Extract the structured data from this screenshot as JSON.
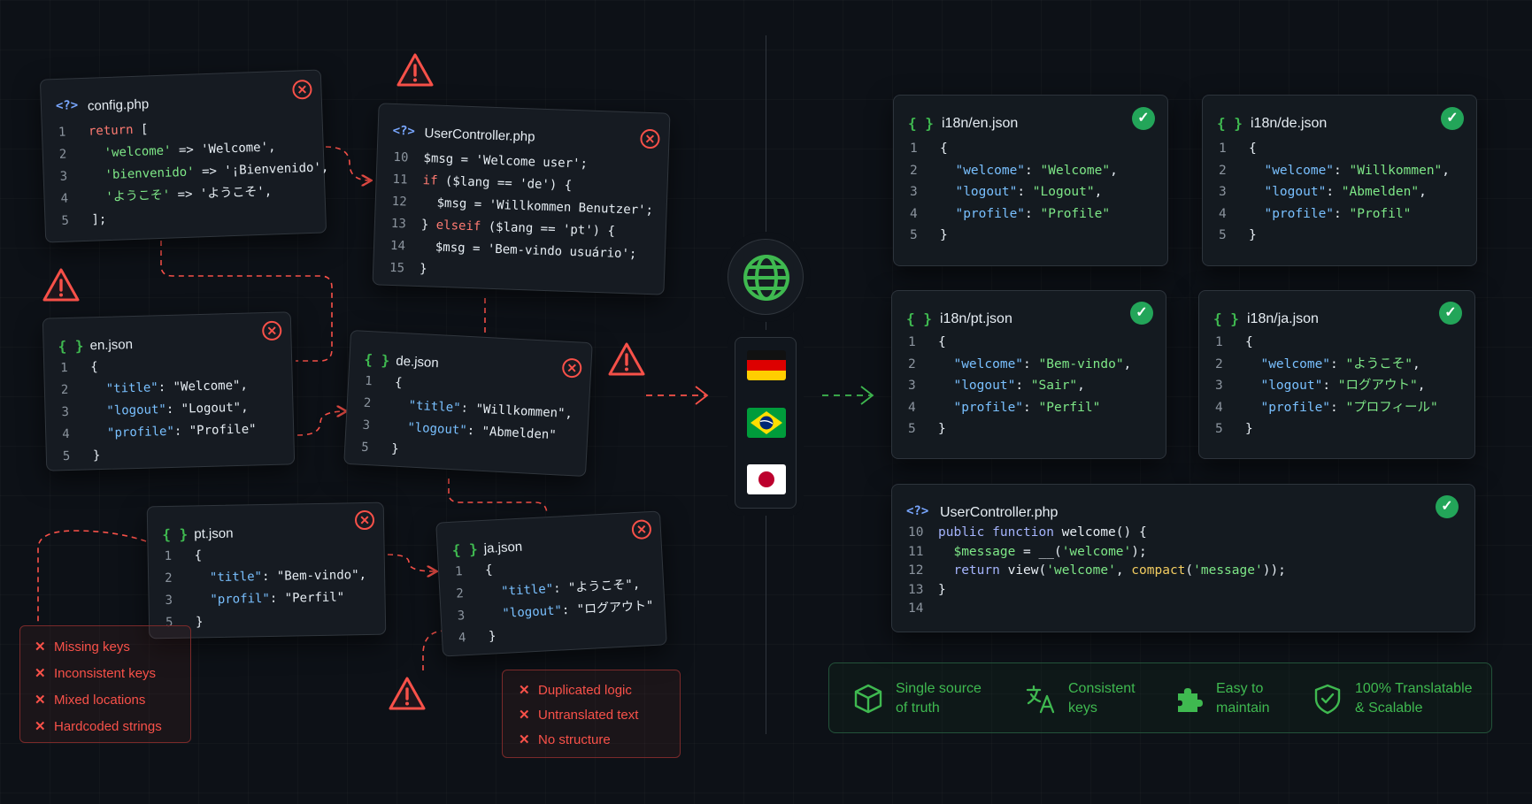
{
  "left_files": [
    {
      "title": "config.php",
      "type": "php",
      "lines": [
        {
          "n": "1",
          "tokens": [
            [
              "kw",
              "return"
            ],
            [
              "p",
              " ["
            ]
          ]
        },
        {
          "n": "2",
          "tokens": [
            [
              "p",
              "  "
            ],
            [
              "str-g",
              "'welcome'"
            ],
            [
              "p",
              " => "
            ],
            [
              "str",
              "'Welcome'"
            ],
            [
              "p",
              ","
            ]
          ]
        },
        {
          "n": "3",
          "tokens": [
            [
              "p",
              "  "
            ],
            [
              "str-g",
              "'bienvenido'"
            ],
            [
              "p",
              " => "
            ],
            [
              "str",
              "'¡Bienvenido'"
            ],
            [
              "p",
              ","
            ]
          ]
        },
        {
          "n": "4",
          "tokens": [
            [
              "p",
              "  "
            ],
            [
              "str-g",
              "'ようこそ'"
            ],
            [
              "p",
              " => "
            ],
            [
              "str",
              "'ようこそ'"
            ],
            [
              "p",
              ","
            ]
          ]
        },
        {
          "n": "5",
          "tokens": [
            [
              "p",
              "];"
            ]
          ]
        }
      ]
    },
    {
      "title": "UserController.php",
      "type": "php",
      "lines": [
        {
          "n": "10",
          "tokens": [
            [
              "p",
              "$msg = "
            ],
            [
              "str",
              "'Welcome user'"
            ],
            [
              "p",
              ";"
            ]
          ]
        },
        {
          "n": "11",
          "tokens": [
            [
              "kw",
              "if"
            ],
            [
              "p",
              " ($lang == "
            ],
            [
              "str",
              "'de'"
            ],
            [
              "p",
              ") {"
            ]
          ]
        },
        {
          "n": "12",
          "tokens": [
            [
              "p",
              "  $msg = "
            ],
            [
              "str",
              "'Willkommen Benutzer'"
            ],
            [
              "p",
              ";"
            ]
          ]
        },
        {
          "n": "13",
          "tokens": [
            [
              "p",
              "} "
            ],
            [
              "kw",
              "elseif"
            ],
            [
              "p",
              " ($lang == "
            ],
            [
              "str",
              "'pt'"
            ],
            [
              "p",
              ") {"
            ]
          ]
        },
        {
          "n": "14",
          "tokens": [
            [
              "p",
              "  $msg = "
            ],
            [
              "str",
              "'Bem-vindo usuário'"
            ],
            [
              "p",
              ";"
            ]
          ]
        },
        {
          "n": "15",
          "tokens": [
            [
              "p",
              "}"
            ]
          ]
        }
      ]
    },
    {
      "title": "en.json",
      "type": "json",
      "lines": [
        {
          "n": "1",
          "tokens": [
            [
              "p",
              "{"
            ]
          ]
        },
        {
          "n": "2",
          "tokens": [
            [
              "p",
              "  "
            ],
            [
              "key",
              "\"title\""
            ],
            [
              "p",
              ": "
            ],
            [
              "str",
              "\"Welcome\""
            ],
            [
              "p",
              ","
            ]
          ]
        },
        {
          "n": "3",
          "tokens": [
            [
              "p",
              "  "
            ],
            [
              "key",
              "\"logout\""
            ],
            [
              "p",
              ": "
            ],
            [
              "str",
              "\"Logout\""
            ],
            [
              "p",
              ","
            ]
          ]
        },
        {
          "n": "4",
          "tokens": [
            [
              "p",
              "  "
            ],
            [
              "key",
              "\"profile\""
            ],
            [
              "p",
              ": "
            ],
            [
              "str",
              "\"Profile\""
            ]
          ]
        },
        {
          "n": "5",
          "tokens": [
            [
              "p",
              "}"
            ]
          ]
        }
      ]
    },
    {
      "title": "de.json",
      "type": "json",
      "lines": [
        {
          "n": "1",
          "tokens": [
            [
              "p",
              "{"
            ]
          ]
        },
        {
          "n": "2",
          "tokens": [
            [
              "p",
              "  "
            ],
            [
              "key",
              "\"title\""
            ],
            [
              "p",
              ": "
            ],
            [
              "str",
              "\"Willkommen\""
            ],
            [
              "p",
              ","
            ]
          ]
        },
        {
          "n": "3",
          "tokens": [
            [
              "p",
              "  "
            ],
            [
              "key",
              "\"logout\""
            ],
            [
              "p",
              ": "
            ],
            [
              "str",
              "\"Abmelden\""
            ]
          ]
        },
        {
          "n": "5",
          "tokens": [
            [
              "p",
              "}"
            ]
          ]
        }
      ]
    },
    {
      "title": "pt.json",
      "type": "json",
      "lines": [
        {
          "n": "1",
          "tokens": [
            [
              "p",
              "{"
            ]
          ]
        },
        {
          "n": "2",
          "tokens": [
            [
              "p",
              "  "
            ],
            [
              "key",
              "\"title\""
            ],
            [
              "p",
              ": "
            ],
            [
              "str",
              "\"Bem-vindo\""
            ],
            [
              "p",
              ","
            ]
          ]
        },
        {
          "n": "3",
          "tokens": [
            [
              "p",
              "  "
            ],
            [
              "key",
              "\"profil\""
            ],
            [
              "p",
              ": "
            ],
            [
              "str",
              "\"Perfil\""
            ]
          ]
        },
        {
          "n": "5",
          "tokens": [
            [
              "p",
              "}"
            ]
          ]
        }
      ]
    },
    {
      "title": "ja.json",
      "type": "json",
      "lines": [
        {
          "n": "1",
          "tokens": [
            [
              "p",
              "{"
            ]
          ]
        },
        {
          "n": "2",
          "tokens": [
            [
              "p",
              "  "
            ],
            [
              "key",
              "\"title\""
            ],
            [
              "p",
              ": "
            ],
            [
              "str",
              "\"ようこそ\""
            ],
            [
              "p",
              ","
            ]
          ]
        },
        {
          "n": "3",
          "tokens": [
            [
              "p",
              "  "
            ],
            [
              "key",
              "\"logout\""
            ],
            [
              "p",
              ": "
            ],
            [
              "str",
              "\"ログアウト\""
            ]
          ]
        },
        {
          "n": "4",
          "tokens": [
            [
              "p",
              "}"
            ]
          ]
        }
      ]
    }
  ],
  "issues_left": [
    "Missing keys",
    "Inconsistent keys",
    "Mixed locations",
    "Hardcoded strings"
  ],
  "issues_right": [
    "Duplicated logic",
    "Untranslated text",
    "No structure"
  ],
  "right_files": [
    {
      "title": "i18n/en.json",
      "type": "json",
      "lines": [
        {
          "n": "1",
          "tokens": [
            [
              "p",
              "{"
            ]
          ]
        },
        {
          "n": "2",
          "tokens": [
            [
              "p",
              "  "
            ],
            [
              "key",
              "\"welcome\""
            ],
            [
              "p",
              ": "
            ],
            [
              "str-g",
              "\"Welcome\""
            ],
            [
              "p",
              ","
            ]
          ]
        },
        {
          "n": "3",
          "tokens": [
            [
              "p",
              "  "
            ],
            [
              "key",
              "\"logout\""
            ],
            [
              "p",
              ": "
            ],
            [
              "str-g",
              "\"Logout\""
            ],
            [
              "p",
              ","
            ]
          ]
        },
        {
          "n": "4",
          "tokens": [
            [
              "p",
              "  "
            ],
            [
              "key",
              "\"profile\""
            ],
            [
              "p",
              ": "
            ],
            [
              "str-g",
              "\"Profile\""
            ]
          ]
        },
        {
          "n": "5",
          "tokens": [
            [
              "p",
              "}"
            ]
          ]
        }
      ]
    },
    {
      "title": "i18n/de.json",
      "type": "json",
      "lines": [
        {
          "n": "1",
          "tokens": [
            [
              "p",
              "{"
            ]
          ]
        },
        {
          "n": "2",
          "tokens": [
            [
              "p",
              "  "
            ],
            [
              "key",
              "\"welcome\""
            ],
            [
              "p",
              ": "
            ],
            [
              "str-g",
              "\"Willkommen\""
            ],
            [
              "p",
              ","
            ]
          ]
        },
        {
          "n": "3",
          "tokens": [
            [
              "p",
              "  "
            ],
            [
              "key",
              "\"logout\""
            ],
            [
              "p",
              ": "
            ],
            [
              "str-g",
              "\"Abmelden\""
            ],
            [
              "p",
              ","
            ]
          ]
        },
        {
          "n": "4",
          "tokens": [
            [
              "p",
              "  "
            ],
            [
              "key",
              "\"profile\""
            ],
            [
              "p",
              ": "
            ],
            [
              "str-g",
              "\"Profil\""
            ]
          ]
        },
        {
          "n": "5",
          "tokens": [
            [
              "p",
              "}"
            ]
          ]
        }
      ]
    },
    {
      "title": "i18n/pt.json",
      "type": "json",
      "lines": [
        {
          "n": "1",
          "tokens": [
            [
              "p",
              "{"
            ]
          ]
        },
        {
          "n": "2",
          "tokens": [
            [
              "p",
              "  "
            ],
            [
              "key",
              "\"welcome\""
            ],
            [
              "p",
              ": "
            ],
            [
              "str-g",
              "\"Bem-vindo\""
            ],
            [
              "p",
              ","
            ]
          ]
        },
        {
          "n": "3",
          "tokens": [
            [
              "p",
              "  "
            ],
            [
              "key",
              "\"logout\""
            ],
            [
              "p",
              ": "
            ],
            [
              "str-g",
              "\"Sair\""
            ],
            [
              "p",
              ","
            ]
          ]
        },
        {
          "n": "4",
          "tokens": [
            [
              "p",
              "  "
            ],
            [
              "key",
              "\"profile\""
            ],
            [
              "p",
              ": "
            ],
            [
              "str-g",
              "\"Perfil\""
            ]
          ]
        },
        {
          "n": "5",
          "tokens": [
            [
              "p",
              "}"
            ]
          ]
        }
      ]
    },
    {
      "title": "i18n/ja.json",
      "type": "json",
      "lines": [
        {
          "n": "1",
          "tokens": [
            [
              "p",
              "{"
            ]
          ]
        },
        {
          "n": "2",
          "tokens": [
            [
              "p",
              "  "
            ],
            [
              "key",
              "\"welcome\""
            ],
            [
              "p",
              ": "
            ],
            [
              "str-g",
              "\"ようこそ\""
            ],
            [
              "p",
              ","
            ]
          ]
        },
        {
          "n": "3",
          "tokens": [
            [
              "p",
              "  "
            ],
            [
              "key",
              "\"logout\""
            ],
            [
              "p",
              ": "
            ],
            [
              "str-g",
              "\"ログアウト\""
            ],
            [
              "p",
              ","
            ]
          ]
        },
        {
          "n": "4",
          "tokens": [
            [
              "p",
              "  "
            ],
            [
              "key",
              "\"profile\""
            ],
            [
              "p",
              ": "
            ],
            [
              "str-g",
              "\"プロフィール\""
            ]
          ]
        },
        {
          "n": "5",
          "tokens": [
            [
              "p",
              "}"
            ]
          ]
        }
      ]
    },
    {
      "title": "UserController.php",
      "type": "php",
      "lines": [
        {
          "n": "10",
          "tokens": [
            [
              "kw-b",
              "public function"
            ],
            [
              "p",
              " welcome() {"
            ]
          ]
        },
        {
          "n": "11",
          "tokens": [
            [
              "p",
              "  "
            ],
            [
              "var",
              "$message"
            ],
            [
              "p",
              " = __("
            ],
            [
              "str-g",
              "'welcome'"
            ],
            [
              "p",
              ");"
            ]
          ]
        },
        {
          "n": "12",
          "tokens": [
            [
              "p",
              "  "
            ],
            [
              "kw-b",
              "return"
            ],
            [
              "p",
              " view("
            ],
            [
              "str-g",
              "'welcome'"
            ],
            [
              "p",
              ", "
            ],
            [
              "fn-y",
              "compact"
            ],
            [
              "p",
              "("
            ],
            [
              "str-g",
              "'message'"
            ],
            [
              "p",
              "));"
            ]
          ]
        },
        {
          "n": "13",
          "tokens": [
            [
              "p",
              "}"
            ]
          ]
        },
        {
          "n": "14",
          "tokens": []
        }
      ]
    }
  ],
  "benefits": [
    {
      "icon": "cube-icon",
      "line1": "Single source",
      "line2": "of truth"
    },
    {
      "icon": "translate-icon",
      "line1": "Consistent",
      "line2": "keys"
    },
    {
      "icon": "puzzle-icon",
      "line1": "Easy to",
      "line2": "maintain"
    },
    {
      "icon": "shield-check-icon",
      "line1": "100% Translatable",
      "line2": "& Scalable"
    }
  ],
  "flags": [
    "germany-flag",
    "brazil-flag",
    "japan-flag"
  ],
  "colors": {
    "background": "#0d1117",
    "card": "#161b22",
    "error": "#f85149",
    "success": "#3fb950",
    "success_badge": "#23a559",
    "key_blue": "#79c0ff"
  }
}
